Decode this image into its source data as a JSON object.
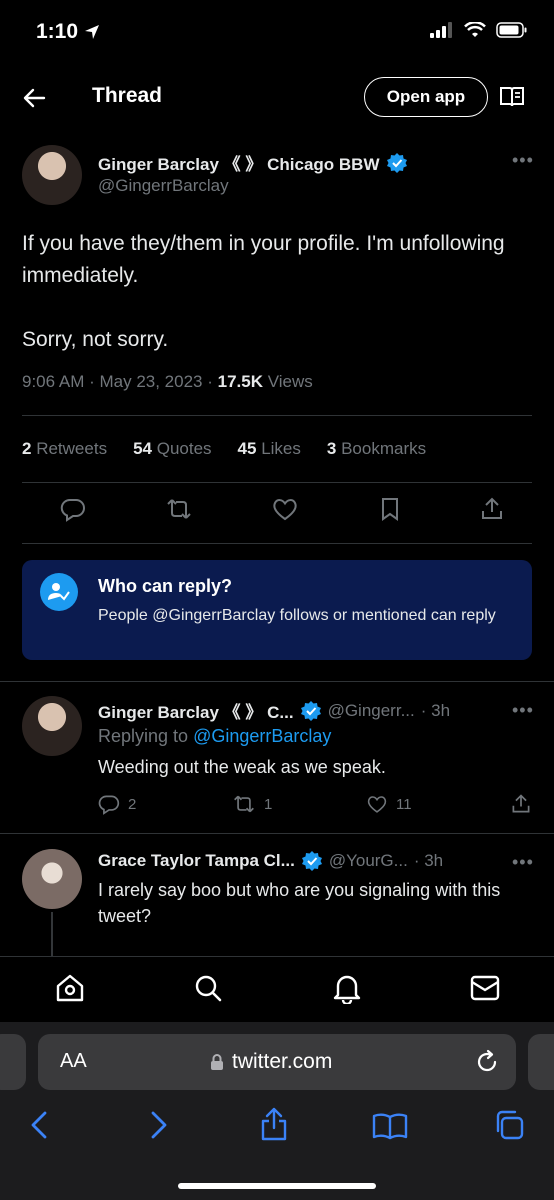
{
  "status": {
    "time": "1:10"
  },
  "header": {
    "title": "Thread",
    "open_app": "Open app"
  },
  "main_tweet": {
    "author_name": "Ginger Barclay 《 》 Chicago BBW",
    "handle": "@GingerrBarclay",
    "text_line1": "If you have they/them in your profile. I'm unfollowing",
    "text_line2": "immediately.",
    "text_line3": "Sorry, not sorry.",
    "time": "9:06 AM · May 23, 2023 · ",
    "views_count": "17.5K",
    "views_label": " Views",
    "stats": {
      "retweets_count": "2",
      "retweets_label": "Retweets",
      "quotes_count": "54",
      "quotes_label": "Quotes",
      "likes_count": "45",
      "likes_label": "Likes",
      "bookmarks_count": "3",
      "bookmarks_label": "Bookmarks"
    }
  },
  "who_can_reply": {
    "title": "Who can reply?",
    "description": "People @GingerrBarclay follows or mentioned can reply"
  },
  "replies": [
    {
      "name": "Ginger Barclay 《 》 C...",
      "handle": "@Gingerr...",
      "time": "· 3h",
      "replying_prefix": "Replying to ",
      "replying_to": "@GingerrBarclay",
      "text": "Weeding out the weak as we speak.",
      "reply_count": "2",
      "retweet_count": "1",
      "like_count": "11"
    },
    {
      "name": "Grace Taylor Tampa Cl...",
      "handle": "@YourG...",
      "time": "· 3h",
      "text_line1": "I rarely say boo but who are you signaling with this",
      "text_line2": "tweet?"
    }
  ],
  "browser": {
    "aa_label": "AA",
    "url": "twitter.com"
  },
  "colors": {
    "accent": "#1d9bf0",
    "reply_box": "#0b1b4f",
    "safari_blue": "#3b82f6"
  }
}
